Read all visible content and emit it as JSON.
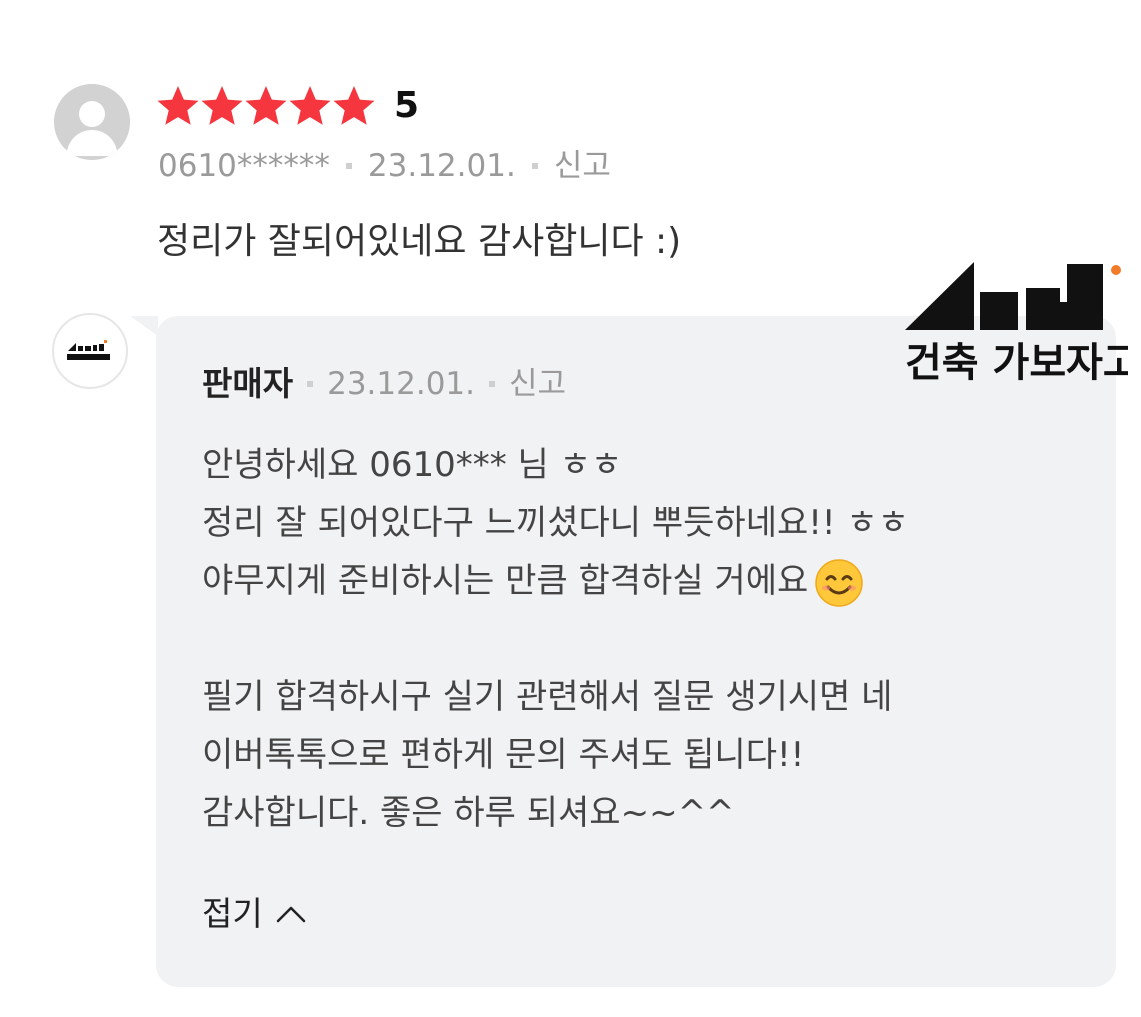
{
  "review": {
    "rating_value": "5",
    "stars_filled": 5,
    "user": "0610******",
    "date": "23.12.01.",
    "report_label": "신고",
    "text": "정리가 잘되어있네요 감사합니다 :)"
  },
  "reply": {
    "seller_label": "판매자",
    "date": "23.12.01.",
    "report_label": "신고",
    "lines": [
      "안녕하세요 0610*** 님 ㅎㅎ",
      "정리 잘 되어있다구 느끼셨다니 뿌듯하네요!! ㅎㅎ",
      "야무지게 준비하시는 만큼 합격하실 거에요",
      "",
      "필기 합격하시구 실기 관련해서 질문 생기시면 네",
      "이버톡톡으로 편하게 문의 주셔도 됩니다!!",
      "감사합니다. 좋은 하루 되셔요~~^^"
    ],
    "fold_label": "접기"
  },
  "brand": {
    "name": "건축 가보자고"
  },
  "colors": {
    "star": "#f5363f",
    "reply_bg": "#f1f2f4",
    "muted_text": "#9a9a9a",
    "brand_dot": "#f07c2a"
  },
  "icons": {
    "avatar": "default-user-icon",
    "emoji": "smiling-face-icon",
    "fold": "chevron-up-icon"
  }
}
